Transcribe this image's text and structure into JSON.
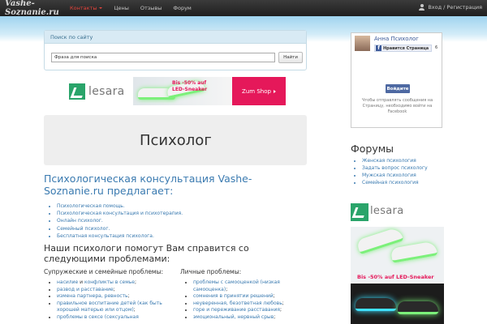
{
  "navbar": {
    "brand": "Vashe-Soznanie.ru",
    "items": [
      {
        "label": "Контакты",
        "active": true
      },
      {
        "label": "Цены",
        "active": false
      },
      {
        "label": "Отзывы",
        "active": false
      },
      {
        "label": "Форум",
        "active": false
      }
    ],
    "login": "Вход / Регистрация"
  },
  "search": {
    "title": "Поиск по сайту",
    "value": "Фраза для поиска",
    "button": "Найти"
  },
  "ad_top": {
    "brand": "lesara",
    "promo_line1": "Bis -50% auf",
    "promo_line2": "LED-Sneaker",
    "button": "Zum Shop"
  },
  "hero": {
    "title": "Психолог"
  },
  "main": {
    "heading": "Психологическая консультация Vashe-Soznanie.ru предлагает:",
    "services": [
      "Психологическая помощь.",
      "Психологическая консультация и психотерапия.",
      "Онлайн психолог.",
      "Семейный психолог.",
      "Бесплатная консультация психолога."
    ],
    "problems_heading": "Наши психологи помогут Вам справится со следующими проблемами:",
    "family": {
      "title": "Супружеские и семейные проблемы:",
      "items": [
        {
          "text": "насилие",
          "rest": " и ",
          "text2": "конфликты в семье",
          "tail": ";"
        },
        {
          "text": "развод и расставание",
          "rest": ";",
          "text2": "",
          "tail": ""
        },
        {
          "text": "измена партнера, ревность",
          "rest": ";",
          "text2": "",
          "tail": ""
        },
        {
          "text": "правильное воспитание детей (как быть хорошей матерью или отцом)",
          "rest": ";",
          "text2": "",
          "tail": ""
        },
        {
          "text": "проблемы в сексе (сексуальная",
          "rest": "",
          "text2": "",
          "tail": ""
        }
      ]
    },
    "personal": {
      "title": "Личные проблемы:",
      "items": [
        {
          "text": "проблемы с самооценкой (низкая самооценка)",
          "rest": ";"
        },
        {
          "text": "сомнения в принятии решений",
          "rest": ";"
        },
        {
          "text": "неуверенная, безответная любовь",
          "rest": ";"
        },
        {
          "text": "горе и переживание расставания",
          "rest": ";",
          "lead": "горе",
          "mid": " и "
        },
        {
          "text": "эмоциональный, нервный срыв",
          "rest": ";"
        }
      ]
    }
  },
  "facebook": {
    "page_name": "Анна Психолог",
    "like_label": "Нравится Страница",
    "count": "6",
    "login_button": "Войдите",
    "note": "Чтобы отправлять сообщения на Страницу, необходимо войти на Facebook"
  },
  "forums": {
    "title": "Форумы",
    "items": [
      "Женская психология",
      "Задать вопрос психологу",
      "Мужская психология",
      "Семейная психология"
    ]
  },
  "ad_side": {
    "brand": "lesara",
    "promo": "Bis -50% auf LED-Sneaker"
  },
  "colors": {
    "link": "#3a7ab0",
    "active_nav": "#e8453c",
    "promo": "#e5185a",
    "facebook": "#3b5998"
  }
}
